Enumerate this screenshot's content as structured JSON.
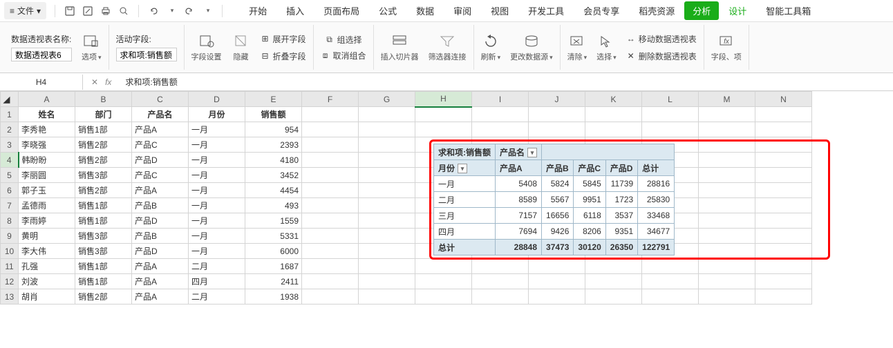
{
  "menubar": {
    "file": "文件",
    "tabs": [
      "开始",
      "插入",
      "页面布局",
      "公式",
      "数据",
      "审阅",
      "视图",
      "开发工具",
      "会员专享",
      "稻壳资源"
    ],
    "analysis": "分析",
    "design": "设计",
    "toolbox": "智能工具箱"
  },
  "ribbon": {
    "pivot_name_label": "数据透视表名称:",
    "pivot_name_value": "数据透视表6",
    "options": "选项",
    "active_field_label": "活动字段:",
    "active_field_value": "求和项:销售额",
    "field_settings": "字段设置",
    "hide": "隐藏",
    "expand_field": "展开字段",
    "collapse_field": "折叠字段",
    "group_select": "组选择",
    "ungroup": "取消组合",
    "insert_slicer": "插入切片器",
    "filter_connections": "筛选器连接",
    "refresh": "刷新",
    "change_source": "更改数据源",
    "clear": "清除",
    "select": "选择",
    "move_pivot": "移动数据透视表",
    "delete_pivot": "删除数据透视表",
    "fields_items": "字段、项"
  },
  "formulabar": {
    "namebox": "H4",
    "content": "求和项:销售额"
  },
  "columns": [
    "A",
    "B",
    "C",
    "D",
    "E",
    "F",
    "G",
    "H",
    "I",
    "J",
    "K",
    "L",
    "M",
    "N"
  ],
  "row_headers": [
    "1",
    "2",
    "3",
    "4",
    "5",
    "6",
    "7",
    "8",
    "9",
    "10",
    "11",
    "12",
    "13"
  ],
  "data_headers": {
    "A": "姓名",
    "B": "部门",
    "C": "产品名",
    "D": "月份",
    "E": "销售额"
  },
  "data_rows": [
    {
      "A": "李秀艳",
      "B": "销售1部",
      "C": "产品A",
      "D": "一月",
      "E": "954"
    },
    {
      "A": "李晓强",
      "B": "销售2部",
      "C": "产品C",
      "D": "一月",
      "E": "2393"
    },
    {
      "A": "韩盼盼",
      "B": "销售2部",
      "C": "产品D",
      "D": "一月",
      "E": "4180"
    },
    {
      "A": "李丽圆",
      "B": "销售3部",
      "C": "产品C",
      "D": "一月",
      "E": "3452"
    },
    {
      "A": "郭子玉",
      "B": "销售2部",
      "C": "产品A",
      "D": "一月",
      "E": "4454"
    },
    {
      "A": "孟德雨",
      "B": "销售1部",
      "C": "产品B",
      "D": "一月",
      "E": "493"
    },
    {
      "A": "李雨婷",
      "B": "销售1部",
      "C": "产品D",
      "D": "一月",
      "E": "1559"
    },
    {
      "A": "黄明",
      "B": "销售3部",
      "C": "产品B",
      "D": "一月",
      "E": "5331"
    },
    {
      "A": "李大伟",
      "B": "销售3部",
      "C": "产品D",
      "D": "一月",
      "E": "6000"
    },
    {
      "A": "孔强",
      "B": "销售1部",
      "C": "产品A",
      "D": "二月",
      "E": "1687"
    },
    {
      "A": "刘波",
      "B": "销售1部",
      "C": "产品A",
      "D": "四月",
      "E": "2411"
    },
    {
      "A": "胡肖",
      "B": "销售2部",
      "C": "产品A",
      "D": "二月",
      "E": "1938"
    }
  ],
  "pivot": {
    "title": "求和项:销售额",
    "col_field": "产品名",
    "row_field": "月份",
    "cols": [
      "产品A",
      "产品B",
      "产品C",
      "产品D"
    ],
    "total_label": "总计",
    "rows": [
      {
        "label": "一月",
        "vals": [
          "5408",
          "5824",
          "5845",
          "11739",
          "28816"
        ]
      },
      {
        "label": "二月",
        "vals": [
          "8589",
          "5567",
          "9951",
          "1723",
          "25830"
        ]
      },
      {
        "label": "三月",
        "vals": [
          "7157",
          "16656",
          "6118",
          "3537",
          "33468"
        ]
      },
      {
        "label": "四月",
        "vals": [
          "7694",
          "9426",
          "8206",
          "9351",
          "34677"
        ]
      }
    ],
    "totals": [
      "28848",
      "37473",
      "30120",
      "26350",
      "122791"
    ]
  },
  "chart_data": {
    "type": "table",
    "title": "求和项:销售额",
    "row_field": "月份",
    "col_field": "产品名",
    "columns": [
      "产品A",
      "产品B",
      "产品C",
      "产品D",
      "总计"
    ],
    "rows": [
      {
        "月份": "一月",
        "产品A": 5408,
        "产品B": 5824,
        "产品C": 5845,
        "产品D": 11739,
        "总计": 28816
      },
      {
        "月份": "二月",
        "产品A": 8589,
        "产品B": 5567,
        "产品C": 9951,
        "产品D": 1723,
        "总计": 25830
      },
      {
        "月份": "三月",
        "产品A": 7157,
        "产品B": 16656,
        "产品C": 6118,
        "产品D": 3537,
        "总计": 33468
      },
      {
        "月份": "四月",
        "产品A": 7694,
        "产品B": 9426,
        "产品C": 8206,
        "产品D": 9351,
        "总计": 34677
      },
      {
        "月份": "总计",
        "产品A": 28848,
        "产品B": 37473,
        "产品C": 30120,
        "产品D": 26350,
        "总计": 122791
      }
    ]
  }
}
